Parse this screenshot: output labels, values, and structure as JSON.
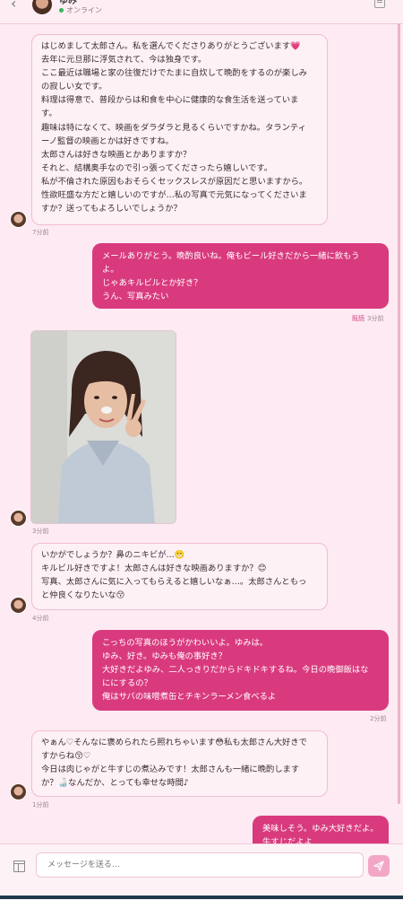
{
  "header": {
    "name": "ゆみ",
    "status": "オンライン"
  },
  "messages": [
    {
      "id": "m1",
      "from": "in",
      "lines": [
        "はじめまして太郎さん。私を選んでくださりありがとうございます💗",
        "去年に元旦那に浮気されて、今は独身です。",
        "ここ最近は職場と家の往復だけでたまに自炊して晩酌をするのが楽しみ",
        "の寂しい女です。",
        "料理は得意で、普段からは和食を中心に健康的な食生活を送っていま",
        "す。",
        "趣味は特になくて、映画をダラダラと見るくらいですかね。タランティ",
        "ーノ監督の映画とかは好きですね。",
        "太郎さんは好きな映画とかありますか？",
        "それと、結構奥手なので引っ張ってくださったら嬉しいです。",
        "私が不倫された原因もおそらくセックスレスが原因だと思いますから。",
        "性欲旺盛な方だと嬉しいのですが…私の写真で元気になってくださいま",
        "すか？送ってもよろしいでしょうか？"
      ],
      "time": "7分前"
    },
    {
      "id": "m2",
      "from": "out",
      "lines": [
        "メールありがとう。晩酌良いね。俺もビール好きだから一緒に飲もう",
        "よ。",
        "じゃあキルビルとか好き？",
        "うん、写真みたい"
      ],
      "read": "既読",
      "time": "3分前"
    },
    {
      "id": "m3",
      "from": "in",
      "type": "photo",
      "time": "3分前"
    },
    {
      "id": "m4",
      "from": "in",
      "lines": [
        "いかがでしょうか？鼻のニキビが…😬",
        "キルビル好きですよ！太郎さんは好きな映画ありますか？😊",
        "写真、太郎さんに気に入ってもらえると嬉しいなぁ…。太郎さんともっ",
        "と仲良くなりたいな😚"
      ],
      "time": "4分前"
    },
    {
      "id": "m5",
      "from": "out",
      "lines": [
        "こっちの写真のほうがかわいいよ。ゆみは。",
        "ゆみ、好き。ゆみも俺の事好き？",
        "大好きだよゆみ、二人っきりだからドキドキするね。今日の晩御飯はな",
        "ににするの？",
        "俺はサバの味噌煮缶とチキンラーメン食べるよ"
      ],
      "time": "2分前"
    },
    {
      "id": "m6",
      "from": "in",
      "lines": [
        "やぁん♡そんなに褒められたら照れちゃいます😳私も太郎さん大好きで",
        "すからね😚♡",
        "今日は肉じゃがと牛すじの煮込みです！太郎さんも一緒に晩酌します",
        "か？🍶なんだか、とっても幸せな時間♪"
      ],
      "time": "1分前"
    },
    {
      "id": "m7",
      "from": "out",
      "lines": [
        "美味しそう。ゆみ大好きだよ。",
        "牛すじだよよ"
      ]
    }
  ],
  "composer": {
    "placeholder": "メッセージを送る…"
  },
  "colors": {
    "background": "#fdeaf2",
    "outgoing_bubble": "#d93a7e",
    "incoming_bubble": "#fdf1f6",
    "online": "#35b85a"
  }
}
